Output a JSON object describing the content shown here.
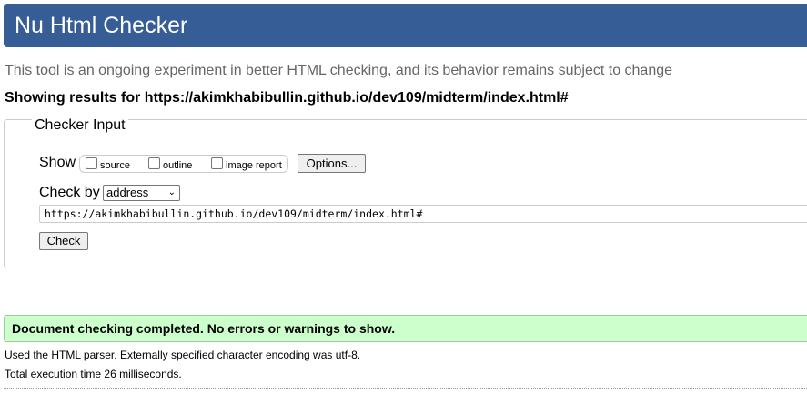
{
  "header": {
    "title": "Nu Html Checker"
  },
  "tagline": "This tool is an ongoing experiment in better HTML checking, and its behavior remains subject to change",
  "showing_results": "Showing results for https://akimkhabibullin.github.io/dev109/midterm/index.html#",
  "checker_input": {
    "legend": "Checker Input",
    "show_label": "Show",
    "options": [
      {
        "label": "source",
        "checked": false
      },
      {
        "label": "outline",
        "checked": false
      },
      {
        "label": "image report",
        "checked": false
      }
    ],
    "options_button": "Options...",
    "check_by_label": "Check by",
    "check_by_value": "address",
    "url_value": "https://akimkhabibullin.github.io/dev109/midterm/index.html#",
    "check_button": "Check"
  },
  "result": {
    "message": "Document checking completed. No errors or warnings to show.",
    "color": "#ccffcc"
  },
  "details": {
    "parser": "Used the HTML parser. Externally specified character encoding was utf-8.",
    "time": "Total execution time 26 milliseconds."
  },
  "colors": {
    "header_bg": "#365d95"
  }
}
